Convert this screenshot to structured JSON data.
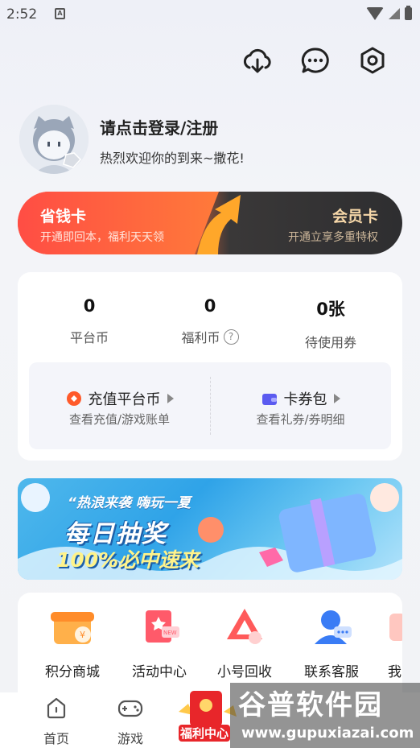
{
  "status": {
    "time": "2:52",
    "sim_label": "A"
  },
  "header": {
    "icons": [
      "download-cloud-icon",
      "message-icon",
      "settings-icon"
    ]
  },
  "profile": {
    "login_label": "请点击登录/注册",
    "welcome": "热烈欢迎你的到来~撒花!"
  },
  "cards": {
    "saving": {
      "title": "省钱卡",
      "subtitle": "开通即回本，福利天天领"
    },
    "member": {
      "title": "会员卡",
      "subtitle": "开通立享多重特权"
    }
  },
  "wallet": {
    "stats": [
      {
        "value": "0",
        "label": "平台币"
      },
      {
        "value": "0",
        "label": "福利币",
        "help": "?"
      },
      {
        "value": "0张",
        "label": "待使用券"
      }
    ],
    "recharge": {
      "title": "充值平台币",
      "subtitle": "查看充值/游戏账单"
    },
    "coupons": {
      "title": "卡券包",
      "subtitle": "查看礼券/券明细"
    }
  },
  "promo": {
    "headline": "“热浪来袭 嗨玩一夏",
    "main": "每日抽奖",
    "sub": "100%必中速来"
  },
  "shortcuts": [
    {
      "label": "积分商城",
      "icon": "points-mall-icon"
    },
    {
      "label": "活动中心",
      "icon": "activity-center-icon"
    },
    {
      "label": "小号回收",
      "icon": "account-recycle-icon"
    },
    {
      "label": "联系客服",
      "icon": "customer-service-icon"
    },
    {
      "label": "我",
      "icon": "partial-icon"
    }
  ],
  "nav": {
    "home": "首页",
    "games": "游戏",
    "welfare": "福利中心"
  },
  "watermark": {
    "name": "谷普软件园",
    "url": "www.gupuxiazai.com"
  },
  "colors": {
    "accent": "#ff5a3c",
    "member_gold": "#f6d7a8"
  }
}
